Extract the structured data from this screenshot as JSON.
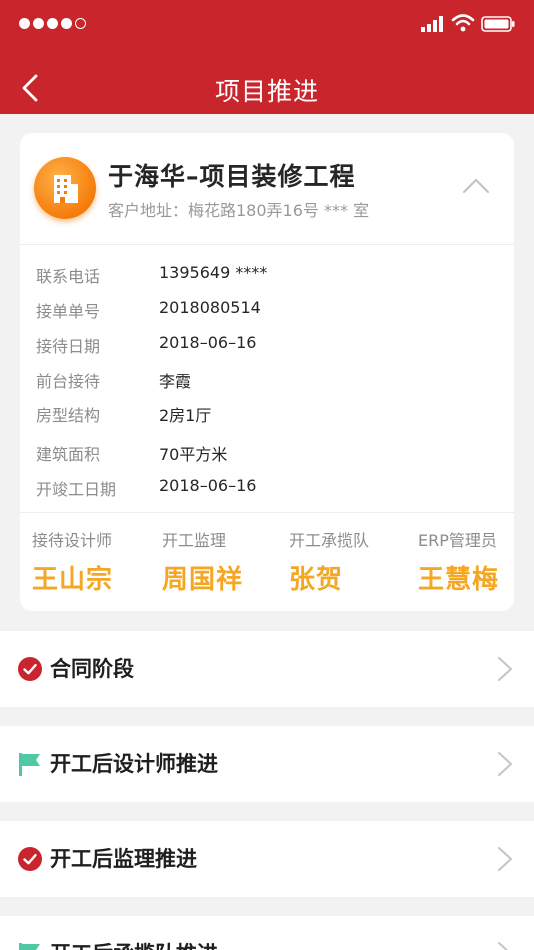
{
  "header": {
    "title": "项目推进",
    "back_icon": "chevron-left-icon",
    "background": "#c8262c"
  },
  "project": {
    "name": "于海华–项目装修工程",
    "address": "客户地址：梅花路180弄16号 *** 室",
    "avatar_icon": "building-icon",
    "avatar_color": "#f57c0a"
  },
  "details": [
    {
      "label": "联系电话",
      "value": "1395649 ****"
    },
    {
      "label": "接单单号",
      "value": "2018080514"
    },
    {
      "label": "接待日期",
      "value": "2018–06–16"
    },
    {
      "label": "前台接待",
      "value": "李霞"
    },
    {
      "label": "房型结构",
      "value": "2房1厅"
    },
    {
      "label": "建筑面积",
      "value": "70平方米"
    },
    {
      "label": "开竣工日期",
      "value": "2018–06–16"
    }
  ],
  "staff": [
    {
      "role": "接待设计师",
      "name": "王山宗"
    },
    {
      "role": "开工监理",
      "name": "周国祥"
    },
    {
      "role": "开工承揽队",
      "name": "张贺"
    },
    {
      "role": "ERP管理员",
      "name": "王慧梅"
    }
  ],
  "stages": [
    {
      "label": "合同阶段",
      "icon": "check-circle-icon"
    },
    {
      "label": "开工后设计师推进",
      "icon": "flag-icon"
    },
    {
      "label": "开工后监理推进",
      "icon": "check-circle-icon"
    },
    {
      "label": "开工后承揽队推进",
      "icon": "flag-icon"
    }
  ],
  "colors": {
    "accent": "#f5a623",
    "check": "#c8262c",
    "flag": "#4fc9a4"
  }
}
